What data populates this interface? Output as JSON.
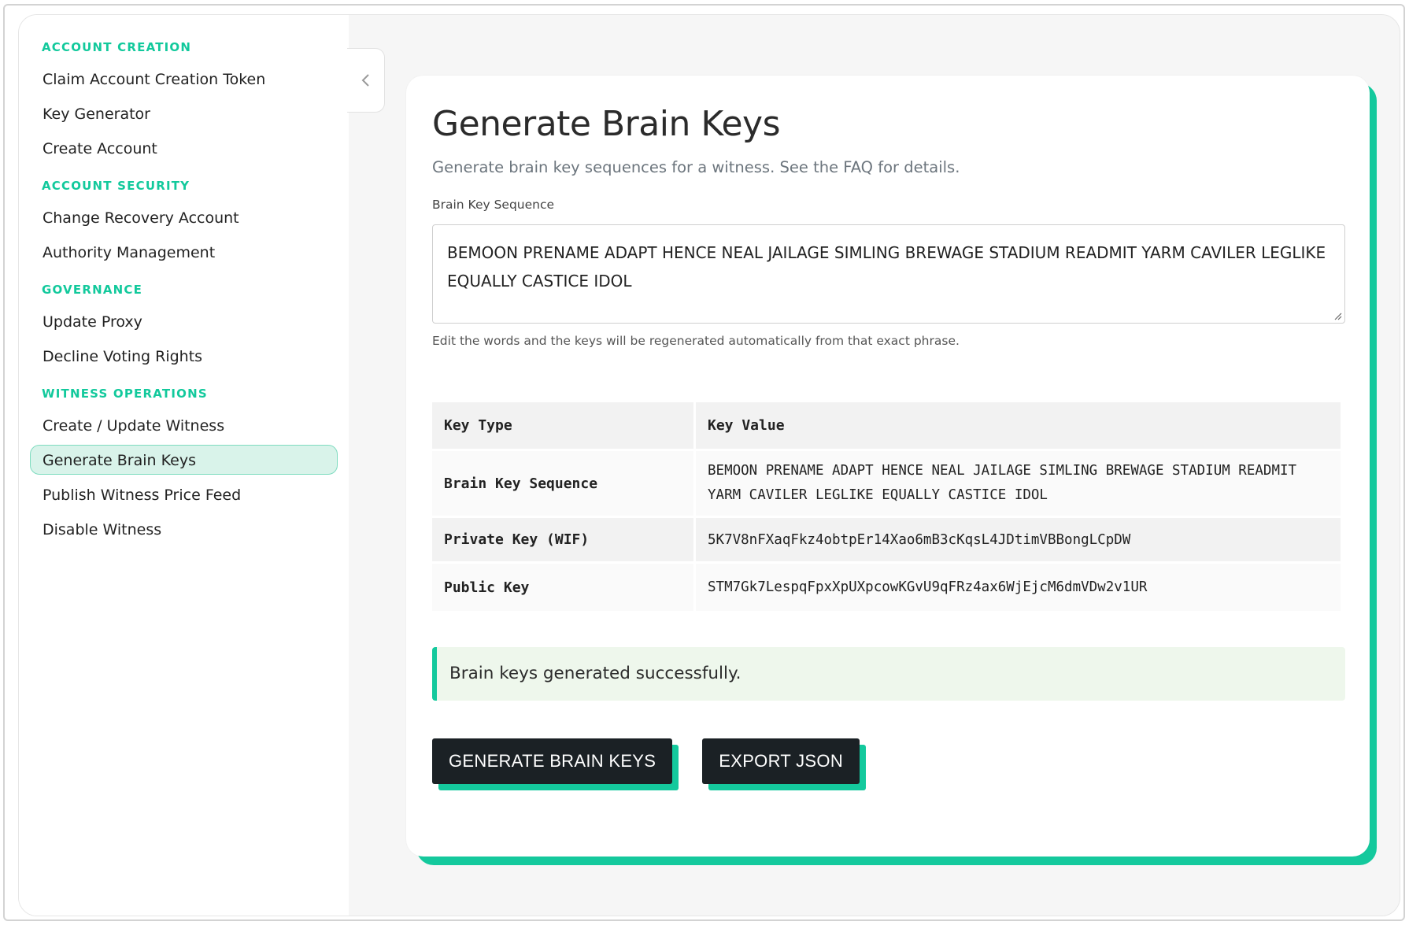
{
  "sidebar": {
    "sections": [
      {
        "title": "ACCOUNT CREATION",
        "items": [
          "Claim Account Creation Token",
          "Key Generator",
          "Create Account"
        ]
      },
      {
        "title": "ACCOUNT SECURITY",
        "items": [
          "Change Recovery Account",
          "Authority Management"
        ]
      },
      {
        "title": "GOVERNANCE",
        "items": [
          "Update Proxy",
          "Decline Voting Rights"
        ]
      },
      {
        "title": "WITNESS OPERATIONS",
        "items": [
          "Create / Update Witness",
          "Generate Brain Keys",
          "Publish Witness Price Feed",
          "Disable Witness"
        ]
      }
    ],
    "active_item": "Generate Brain Keys"
  },
  "page": {
    "title": "Generate Brain Keys",
    "subtitle": "Generate brain key sequences for a witness. See the FAQ for details.",
    "field_label": "Brain Key Sequence",
    "brain_key_value": "BEMOON PRENAME ADAPT HENCE NEAL JAILAGE SIMLING BREWAGE STADIUM READMIT YARM CAVILER LEGLIKE EQUALLY CASTICE IDOL",
    "help_text": "Edit the words and the keys will be regenerated automatically from that exact phrase."
  },
  "table": {
    "headers": [
      "Key Type",
      "Key Value"
    ],
    "rows": [
      {
        "type": "Brain Key Sequence",
        "value": "BEMOON PRENAME ADAPT HENCE NEAL JAILAGE SIMLING BREWAGE STADIUM READMIT YARM CAVILER LEGLIKE EQUALLY CASTICE IDOL"
      },
      {
        "type": "Private Key (WIF)",
        "value": "5K7V8nFXaqFkz4obtpEr14Xao6mB3cKqsL4JDtimVBBongLCpDW"
      },
      {
        "type": "Public Key",
        "value": "STM7Gk7LespqFpxXpUXpcowKGvU9qFRz4ax6WjEjcM6dmVDw2v1UR"
      }
    ]
  },
  "alert": {
    "message": "Brain keys generated successfully."
  },
  "buttons": {
    "generate": "GENERATE BRAIN KEYS",
    "export": "EXPORT JSON"
  },
  "colors": {
    "accent": "#14c99d",
    "active_bg": "#d9f3ea",
    "button_bg": "#1b2125",
    "alert_bg": "#eef7ec"
  },
  "icons": {
    "collapse": "chevron-left-icon"
  }
}
